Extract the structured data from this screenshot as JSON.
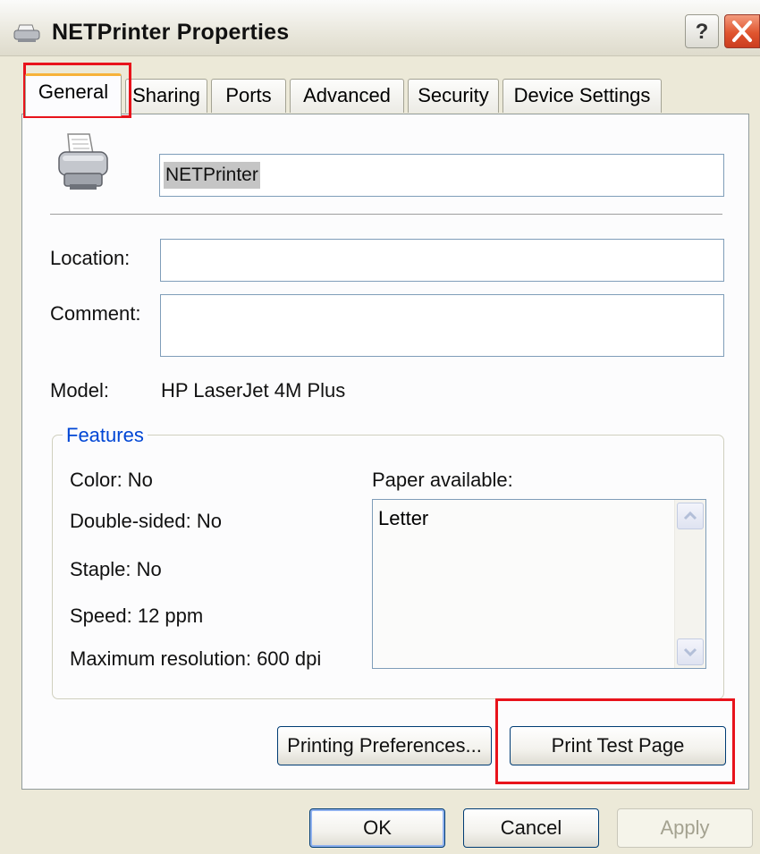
{
  "window": {
    "title": "NETPrinter Properties",
    "help_label": "?"
  },
  "tabs": [
    {
      "label": "General"
    },
    {
      "label": "Sharing"
    },
    {
      "label": "Ports"
    },
    {
      "label": "Advanced"
    },
    {
      "label": "Security"
    },
    {
      "label": "Device Settings"
    }
  ],
  "general": {
    "printer_name": "NETPrinter",
    "location_label": "Location:",
    "location_value": "",
    "comment_label": "Comment:",
    "comment_value": "",
    "model_label": "Model:",
    "model_value": "HP LaserJet 4M Plus"
  },
  "features": {
    "legend": "Features",
    "color": "Color: No",
    "double_sided": "Double-sided: No",
    "staple": "Staple: No",
    "speed": "Speed: 12 ppm",
    "max_resolution": "Maximum resolution: 600 dpi",
    "paper_label": "Paper available:",
    "paper_items": [
      "Letter"
    ]
  },
  "buttons": {
    "printing_preferences": "Printing Preferences...",
    "print_test_page": "Print Test Page",
    "ok": "OK",
    "cancel": "Cancel",
    "apply": "Apply"
  },
  "colors": {
    "highlight": "#e8131b",
    "legend": "#0046d5",
    "active_tab_accent": "#f7b23a"
  }
}
